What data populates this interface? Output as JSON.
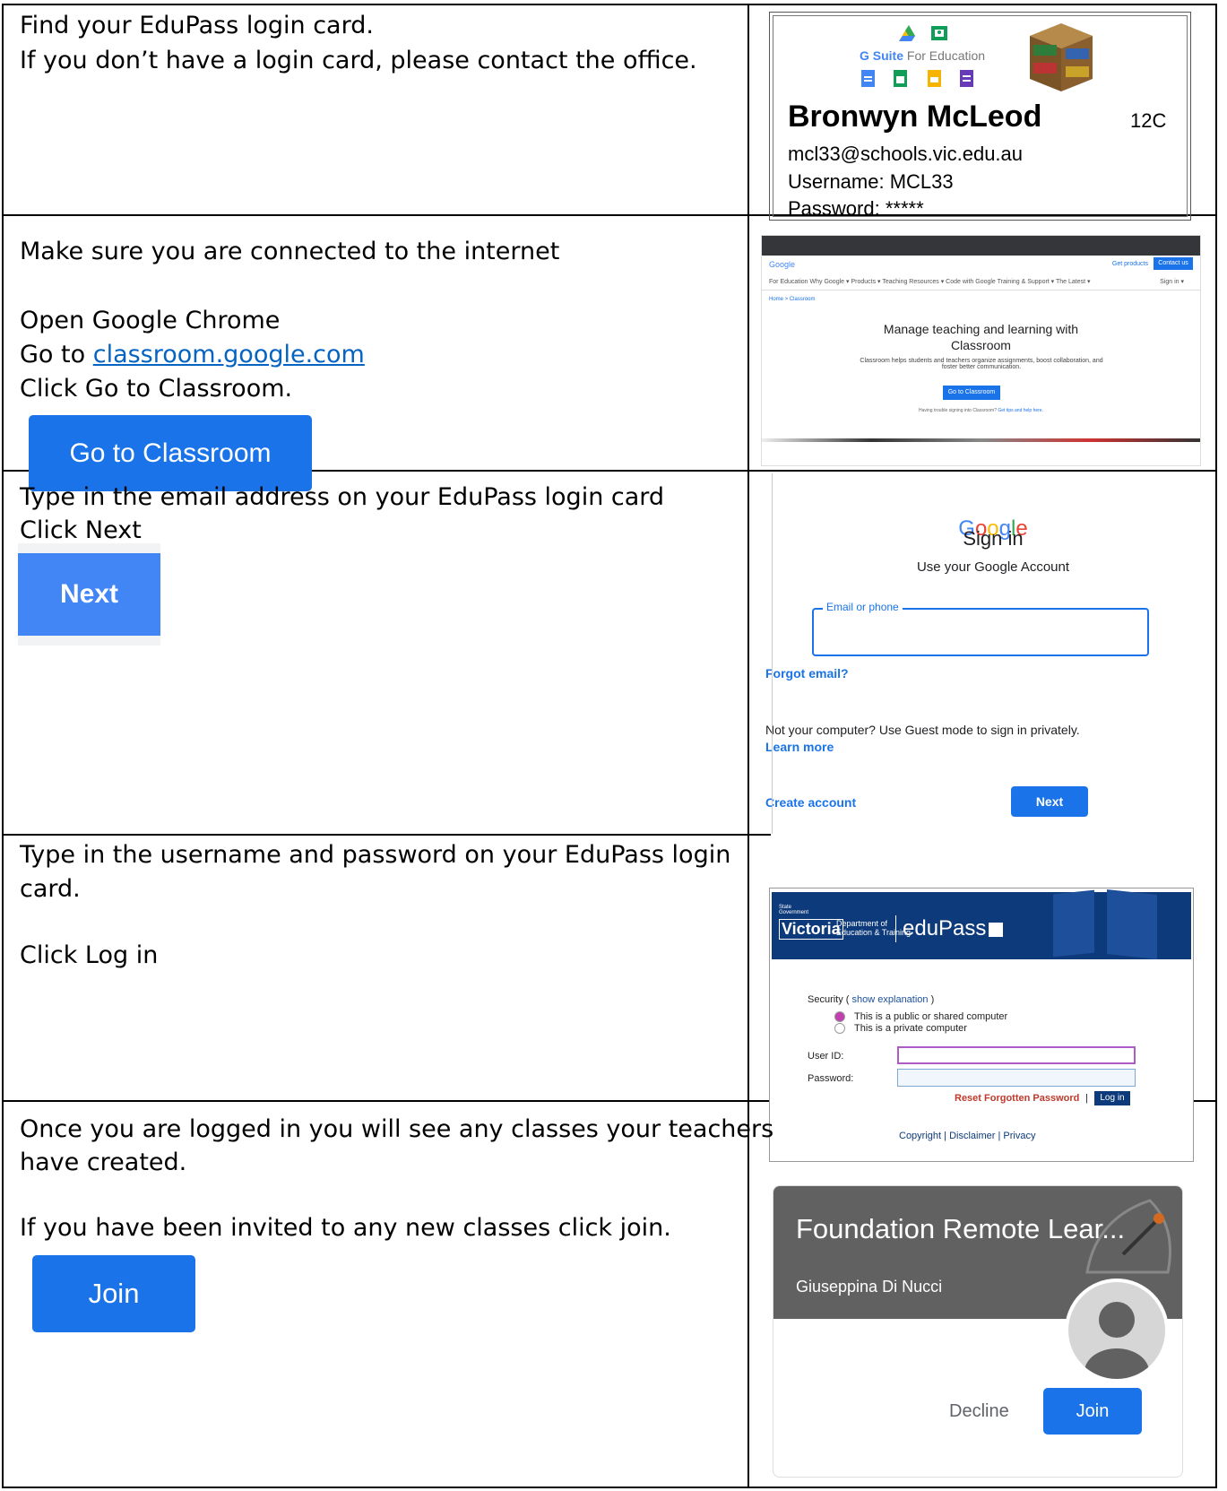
{
  "row1": {
    "line1": "Find your EduPass login card.",
    "line2": "If you don’t have a login card, please contact the office."
  },
  "card": {
    "gsuite_g": "G Suite",
    "gsuite_rest": "For Education",
    "name": "Bronwyn McLeod",
    "class": "12C",
    "email": "mcl33@schools.vic.edu.au",
    "username": "Username:  MCL33",
    "password": "Password:  *****"
  },
  "row2": {
    "line1": "Make sure you are connected to the internet",
    "line2": "Open Google Chrome",
    "goto_prefix": "Go to ",
    "link": "classroom.google.com",
    "line4": "Click Go to Classroom.",
    "button": "Go to Classroom"
  },
  "shot2": {
    "logo": "Google",
    "get_products": "Get products",
    "contact": "Contact us",
    "nav": "For Education    Why Google ▾    Products ▾    Teaching Resources ▾    Code with Google    Training & Support ▾    The Latest ▾",
    "signin": "Sign in ▾",
    "breadcrumb": "Home > Classroom",
    "heading1": "Manage teaching and learning with",
    "heading2": "Classroom",
    "desc": "Classroom helps students and teachers organize assignments, boost collaboration, and foster better communication.",
    "button": "Go to Classroom",
    "trouble": "Having trouble signing into Classroom?",
    "trouble_link": "Get tips and help here."
  },
  "row3": {
    "line1": "Type in the email address on your EduPass login card",
    "line2": "Click Next",
    "button": "Next"
  },
  "gsign": {
    "logo": "Google",
    "title": "Sign in",
    "subtitle": "Use your Google Account",
    "field_label": "Email or phone",
    "forgot": "Forgot email?",
    "guest": "Not your computer? Use Guest mode to sign in privately.",
    "learn": "Learn more",
    "create": "Create account",
    "next": "Next"
  },
  "row4": {
    "line1": "Type in the username and password on your EduPass login",
    "line2": "card.",
    "line3": "Click Log in"
  },
  "edu": {
    "state": "State Government",
    "victoria": "Victoria",
    "dept1": "Department of",
    "dept2": "Education & Training",
    "brand": "eduPass",
    "security": "Security (",
    "show": "show explanation",
    "security_end": ")",
    "public": "This is a public or shared computer",
    "private": "This is a private computer",
    "userid": "User ID:",
    "password": "Password:",
    "reset": "Reset Forgotten Password",
    "sep": "|",
    "login": "Log in",
    "copyright": "Copyright",
    "disclaimer": "Disclaimer",
    "privacy": "Privacy"
  },
  "row5": {
    "line1": "Once you are logged in you will see any classes your teachers",
    "line2": "have created.",
    "line3": "If you have been invited to any new classes click join.",
    "button": "Join"
  },
  "cls": {
    "title": "Foundation Remote Lear...",
    "teacher": "Giuseppina Di Nucci",
    "decline": "Decline",
    "join": "Join"
  },
  "colors": {
    "google_blue": "#1a73e8",
    "edupass_navy": "#0d3a7a",
    "link_blue": "#0563c1"
  }
}
